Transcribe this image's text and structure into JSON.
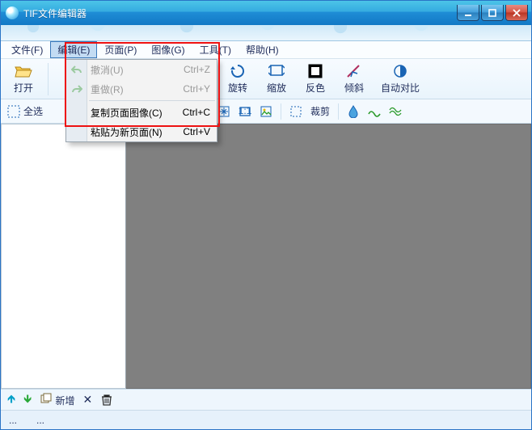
{
  "window": {
    "title": "TIF文件编辑器"
  },
  "menubar": {
    "file": "文件(F)",
    "edit": "编辑(E)",
    "page": "页面(P)",
    "image": "图像(G)",
    "tools": "工具(T)",
    "help": "帮助(H)"
  },
  "edit_menu": {
    "undo": {
      "label": "撤消(U)",
      "shortcut": "Ctrl+Z"
    },
    "redo": {
      "label": "重做(R)",
      "shortcut": "Ctrl+Y"
    },
    "copy_page_image": {
      "label": "复制页面图像(C)",
      "shortcut": "Ctrl+C"
    },
    "paste_as_new_page": {
      "label": "粘贴为新页面(N)",
      "shortcut": "Ctrl+V"
    }
  },
  "toolbar": {
    "open": "打开",
    "rotate": "旋转",
    "zoom": "缩放",
    "invert": "反色",
    "skew": "倾斜",
    "auto_contrast": "自动对比"
  },
  "toolbar2": {
    "select_all": "全选",
    "crop": "裁剪"
  },
  "status": {
    "add": "新增",
    "ellipsis1": "...",
    "ellipsis2": "..."
  }
}
